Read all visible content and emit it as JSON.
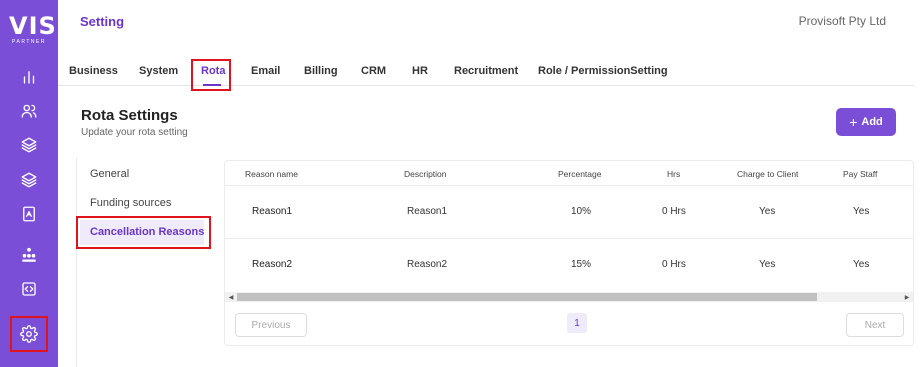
{
  "brand": {
    "logo_text": "VIS",
    "logo_sub": "PARTNER"
  },
  "sidebar": {
    "icons": [
      "chart-icon",
      "users-icon",
      "layers-icon",
      "stack-icon",
      "document-icon",
      "org-chart-icon",
      "code-icon",
      "gear-icon"
    ]
  },
  "header": {
    "title": "Setting",
    "company": "Provisoft Pty Ltd"
  },
  "tabs": [
    {
      "label": "Business"
    },
    {
      "label": "System"
    },
    {
      "label": "Rota"
    },
    {
      "label": "Email"
    },
    {
      "label": "Billing"
    },
    {
      "label": "CRM"
    },
    {
      "label": "HR"
    },
    {
      "label": "Recruitment"
    },
    {
      "label": "Role / PermissionSetting"
    }
  ],
  "section": {
    "title": "Rota Settings",
    "subtitle": "Update your rota setting",
    "add_label": "Add"
  },
  "submenu": [
    {
      "label": "General"
    },
    {
      "label": "Funding sources"
    },
    {
      "label": "Cancellation Reasons"
    }
  ],
  "table": {
    "headers": [
      "Reason name",
      "Description",
      "Percentage",
      "Hrs",
      "Charge to Client",
      "Pay Staff"
    ],
    "rows": [
      [
        "Reason1",
        "Reason1",
        "10%",
        "0 Hrs",
        "Yes",
        "Yes"
      ],
      [
        "Reason2",
        "Reason2",
        "15%",
        "0 Hrs",
        "Yes",
        "Yes"
      ]
    ]
  },
  "pagination": {
    "previous": "Previous",
    "current_page": "1",
    "next": "Next"
  },
  "colors": {
    "accent": "#7b4ed8",
    "accent_text": "#6b35c9",
    "highlight": "#e0141e"
  }
}
